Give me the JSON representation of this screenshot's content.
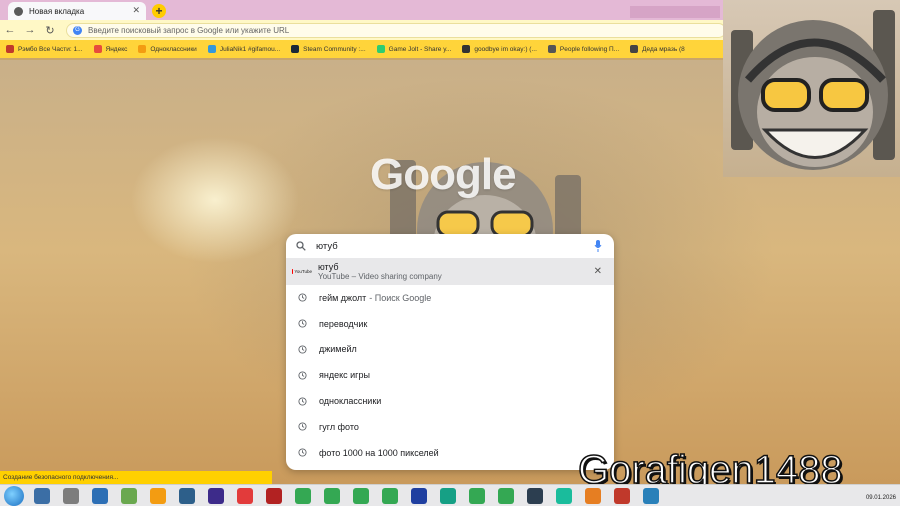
{
  "browser": {
    "tab_title": "Новая вкладка",
    "new_tab_symbol": "+",
    "close_symbol": "✕",
    "address_placeholder": "Введите поисковый запрос в Google или укажите URL"
  },
  "bookmarks": [
    {
      "label": "Рэмбо Все Части: 1...",
      "color": "#c0392b"
    },
    {
      "label": "Яндекс",
      "color": "#e74c3c"
    },
    {
      "label": "Одноклассники",
      "color": "#f39c12"
    },
    {
      "label": "JuliaNik1 #gifamou...",
      "color": "#3498db"
    },
    {
      "label": "Steam Community :...",
      "color": "#1b2838"
    },
    {
      "label": "Game Jolt - Share y...",
      "color": "#2ecc71"
    },
    {
      "label": "goodbye im okay:) (...",
      "color": "#333333"
    },
    {
      "label": "People following П...",
      "color": "#555555"
    },
    {
      "label": "Деда мразь (8",
      "color": "#444444"
    }
  ],
  "logo_text": "Google",
  "search": {
    "query": "ютуб",
    "top_suggestion": {
      "title": "ютуб",
      "subtitle": "YouTube – Video sharing company",
      "icon": "youtube-icon",
      "yt_word": "YouTube"
    },
    "suggestions": [
      {
        "text": "гейм джолт",
        "sub": "- Поиск Google"
      },
      {
        "text": "переводчик",
        "sub": ""
      },
      {
        "text": "джимейл",
        "sub": ""
      },
      {
        "text": "яндекс игры",
        "sub": ""
      },
      {
        "text": "одноклассники",
        "sub": ""
      },
      {
        "text": "гугл фото",
        "sub": ""
      },
      {
        "text": "фото 1000 на 1000 пикселей",
        "sub": ""
      }
    ]
  },
  "status_text": "Создание безопасного подключения...",
  "watermark": "Gorafigen1488",
  "taskbar": {
    "date": "09.01.2026",
    "icons": [
      "#3b6ea5",
      "#7d7d7d",
      "#2d6fb5",
      "#6aa84f",
      "#f39c12",
      "#2d5f8a",
      "#3d2b8a",
      "#e23b3b",
      "#b22222",
      "#34a853",
      "#34a853",
      "#34a853",
      "#34a853",
      "#1f3fa0",
      "#16a085",
      "#34a853",
      "#34a853",
      "#2c3e50",
      "#1abc9c",
      "#e67e22",
      "#c0392b",
      "#2980b9"
    ]
  },
  "colors": {
    "tabbar": "#e4b9d6",
    "toolbar": "#fff8c6",
    "bookmarks": "#ffd43a",
    "status": "#ffd000"
  }
}
